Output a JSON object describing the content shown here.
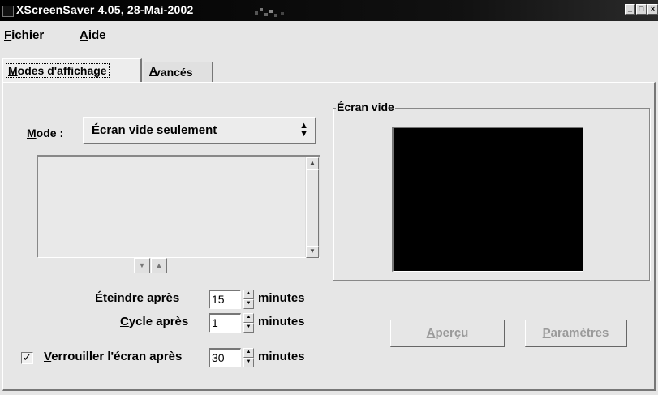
{
  "window": {
    "title": "XScreenSaver 4.05, 28-Mai-2002",
    "controls": [
      "_",
      "□",
      "×"
    ]
  },
  "menubar": {
    "items": [
      {
        "mnemonic": "F",
        "rest": "ichier"
      },
      {
        "mnemonic": "A",
        "rest": "ide"
      }
    ]
  },
  "tabs": {
    "display_modes": {
      "mnemonic": "M",
      "rest": "odes d'affichage"
    },
    "advanced": {
      "mnemonic": "A",
      "rest": "vancés"
    }
  },
  "mode": {
    "label_mnemonic": "M",
    "label_rest": "ode :",
    "selected": "Écran vide seulement",
    "arrow": "▲▼"
  },
  "mode_list": {
    "items": [],
    "scroll_up": "▲",
    "scroll_down": "▼"
  },
  "list_nav": {
    "down": "▼",
    "up": "▲"
  },
  "settings": {
    "blank_after": {
      "label_mnemonic": "É",
      "label_rest": "teindre après",
      "value": "15",
      "unit": "minutes"
    },
    "cycle_after": {
      "label_mnemonic": "C",
      "label_rest": "ycle après",
      "value": "1",
      "unit": "minutes"
    },
    "lock_after": {
      "checked": true,
      "check_glyph": "✓",
      "label_mnemonic": "V",
      "label_rest": "errouiller l'écran après",
      "value": "30",
      "unit": "minutes"
    }
  },
  "spin": {
    "up": "▲",
    "down": "▼"
  },
  "preview": {
    "title": "Écran vide",
    "screen_color": "#000000"
  },
  "buttons": {
    "preview": {
      "mnemonic": "A",
      "rest": "perçu"
    },
    "settings": {
      "mnemonic": "P",
      "rest": "aramètres"
    }
  }
}
